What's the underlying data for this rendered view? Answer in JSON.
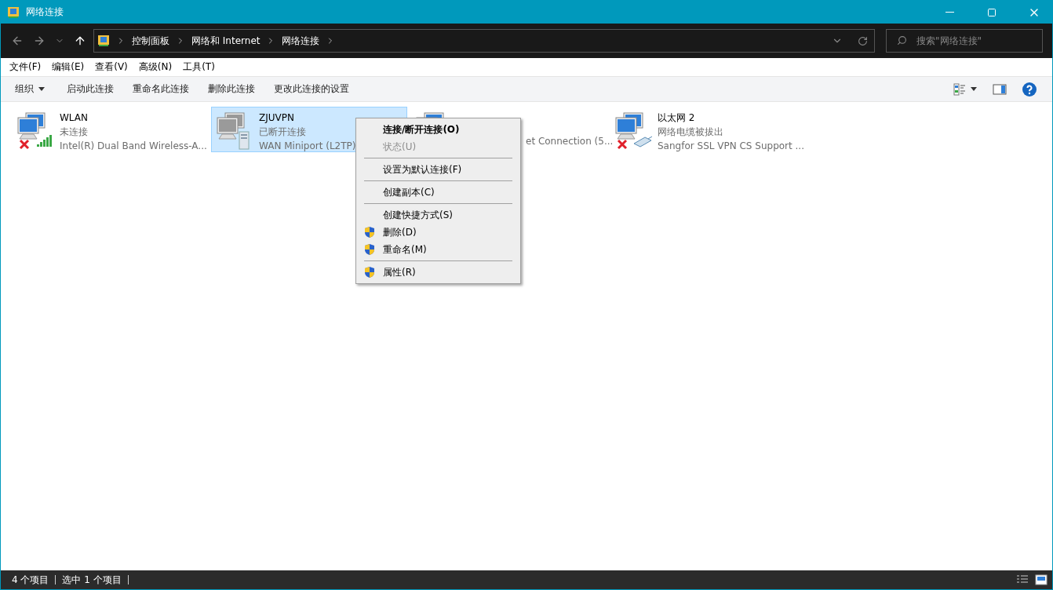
{
  "window": {
    "title": "网络连接"
  },
  "address": {
    "crumbs": [
      "控制面板",
      "网络和 Internet",
      "网络连接"
    ],
    "search_placeholder": "搜索\"网络连接\""
  },
  "menubar": [
    "文件(F)",
    "编辑(E)",
    "查看(V)",
    "高级(N)",
    "工具(T)"
  ],
  "commands": [
    {
      "label": "组织",
      "kind": "dropdown"
    },
    {
      "label": "启动此连接",
      "kind": "plain"
    },
    {
      "label": "重命名此连接",
      "kind": "plain"
    },
    {
      "label": "删除此连接",
      "kind": "plain"
    },
    {
      "label": "更改此连接的设置",
      "kind": "plain"
    }
  ],
  "connections": [
    {
      "name": "WLAN",
      "status": "未连接",
      "device": "Intel(R) Dual Band Wireless-A...",
      "kind": "wifi",
      "disconnected": true,
      "selected": false,
      "covered": false
    },
    {
      "name": "ZJUVPN",
      "status": "已断开连接",
      "device": "WAN Miniport (L2TP)",
      "kind": "vpn",
      "disconnected": false,
      "selected": true,
      "covered": false
    },
    {
      "device": "et Connection (5...",
      "kind": "ethernet",
      "disconnected": false,
      "selected": false,
      "covered": true
    },
    {
      "name": "以太网 2",
      "status": "网络电缆被拔出",
      "device": "Sangfor SSL VPN CS Support ...",
      "kind": "ethernet",
      "disconnected": true,
      "selected": false,
      "covered": false
    }
  ],
  "context_menu": [
    {
      "kind": "item",
      "label": "连接/断开连接(O)",
      "bold": true,
      "disabled": false,
      "shield": false
    },
    {
      "kind": "item",
      "label": "状态(U)",
      "bold": false,
      "disabled": true,
      "shield": false
    },
    {
      "kind": "separator"
    },
    {
      "kind": "item",
      "label": "设置为默认连接(F)",
      "bold": false,
      "disabled": false,
      "shield": false
    },
    {
      "kind": "separator"
    },
    {
      "kind": "item",
      "label": "创建副本(C)",
      "bold": false,
      "disabled": false,
      "shield": false
    },
    {
      "kind": "separator"
    },
    {
      "kind": "item",
      "label": "创建快捷方式(S)",
      "bold": false,
      "disabled": false,
      "shield": false
    },
    {
      "kind": "item",
      "label": "删除(D)",
      "bold": false,
      "disabled": false,
      "shield": true
    },
    {
      "kind": "item",
      "label": "重命名(M)",
      "bold": false,
      "disabled": false,
      "shield": true
    },
    {
      "kind": "separator"
    },
    {
      "kind": "item",
      "label": "属性(R)",
      "bold": false,
      "disabled": false,
      "shield": true
    }
  ],
  "status_bar": {
    "count": "4 个项目",
    "selection": "选中 1 个项目"
  }
}
